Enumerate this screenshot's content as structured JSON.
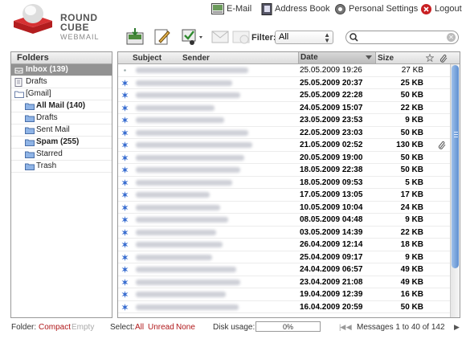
{
  "logo": {
    "line1": "ROUND",
    "line2": "CUBE",
    "line3": "WEBMAIL"
  },
  "nav": {
    "email": "E-Mail",
    "addressbook": "Address Book",
    "settings": "Personal Settings",
    "logout": "Logout"
  },
  "toolbar": {
    "filter_label": "Filter:",
    "filter_value": "All",
    "search_placeholder": ""
  },
  "folders": {
    "header": "Folders",
    "items": [
      {
        "label": "Inbox (139)",
        "icon": "inbox-icon"
      },
      {
        "label": "Drafts",
        "icon": "drafts-icon"
      },
      {
        "label": "[Gmail]",
        "icon": "folder-icon"
      },
      {
        "label": "All Mail (140)",
        "icon": "folder-icon"
      },
      {
        "label": "Drafts",
        "icon": "folder-icon"
      },
      {
        "label": "Sent Mail",
        "icon": "folder-icon"
      },
      {
        "label": "Spam (255)",
        "icon": "folder-icon"
      },
      {
        "label": "Starred",
        "icon": "folder-icon"
      },
      {
        "label": "Trash",
        "icon": "folder-icon"
      }
    ]
  },
  "list": {
    "columns": {
      "subject": "Subject",
      "sender": "Sender",
      "date": "Date",
      "size": "Size"
    },
    "rows": [
      {
        "date": "25.05.2009 19:26",
        "size": "27 KB",
        "unread": false,
        "attach": false
      },
      {
        "date": "25.05.2009 20:37",
        "size": "25 KB",
        "unread": true,
        "attach": false
      },
      {
        "date": "25.05.2009 22:28",
        "size": "50 KB",
        "unread": true,
        "attach": false
      },
      {
        "date": "24.05.2009 15:07",
        "size": "22 KB",
        "unread": true,
        "attach": false
      },
      {
        "date": "23.05.2009 23:53",
        "size": "9 KB",
        "unread": true,
        "attach": false
      },
      {
        "date": "22.05.2009 23:03",
        "size": "50 KB",
        "unread": true,
        "attach": false
      },
      {
        "date": "21.05.2009 02:52",
        "size": "130 KB",
        "unread": true,
        "attach": true
      },
      {
        "date": "20.05.2009 19:00",
        "size": "50 KB",
        "unread": true,
        "attach": false
      },
      {
        "date": "18.05.2009 22:38",
        "size": "50 KB",
        "unread": true,
        "attach": false
      },
      {
        "date": "18.05.2009 09:53",
        "size": "5 KB",
        "unread": true,
        "attach": false
      },
      {
        "date": "17.05.2009 13:05",
        "size": "17 KB",
        "unread": true,
        "attach": false
      },
      {
        "date": "10.05.2009 10:04",
        "size": "24 KB",
        "unread": true,
        "attach": false
      },
      {
        "date": "08.05.2009 04:48",
        "size": "9 KB",
        "unread": true,
        "attach": false
      },
      {
        "date": "03.05.2009 14:39",
        "size": "22 KB",
        "unread": true,
        "attach": false
      },
      {
        "date": "26.04.2009 12:14",
        "size": "18 KB",
        "unread": true,
        "attach": false
      },
      {
        "date": "25.04.2009 09:17",
        "size": "9 KB",
        "unread": true,
        "attach": false
      },
      {
        "date": "24.04.2009 06:57",
        "size": "49 KB",
        "unread": true,
        "attach": false
      },
      {
        "date": "23.04.2009 21:08",
        "size": "49 KB",
        "unread": true,
        "attach": false
      },
      {
        "date": "19.04.2009 12:39",
        "size": "16 KB",
        "unread": true,
        "attach": false
      },
      {
        "date": "16.04.2009 20:59",
        "size": "50 KB",
        "unread": true,
        "attach": false
      }
    ]
  },
  "footer": {
    "folder_label": "Folder:",
    "compact": "Compact",
    "empty": "Empty",
    "select_label": "Select:",
    "sel_all": "All",
    "sel_unread": "Unread",
    "sel_none": "None",
    "disk_label": "Disk usage:",
    "disk_value": "0%",
    "messages": "Messages 1 to 40 of 142"
  },
  "colors": {
    "accent": "#b0181a",
    "selected_folder": "#929292",
    "unread_star": "#3b6fd1",
    "scroll_thumb": "#5f8fd0"
  }
}
